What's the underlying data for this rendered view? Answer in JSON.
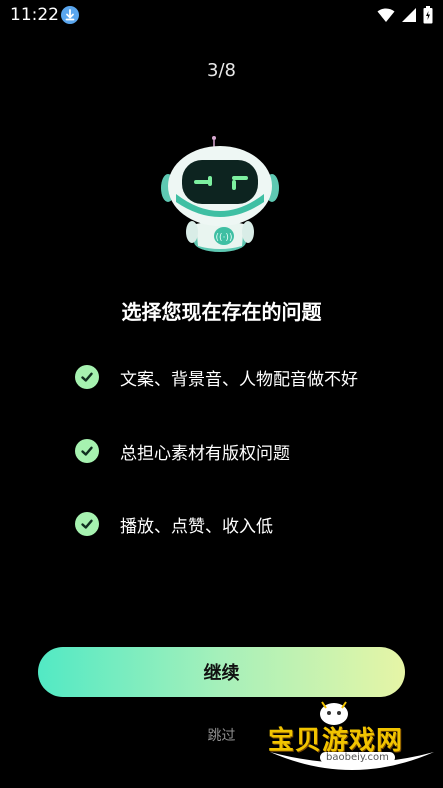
{
  "status_bar": {
    "time": "11:22"
  },
  "progress": "3/8",
  "question_title": "选择您现在存在的问题",
  "options": [
    {
      "label": "文案、背景音、人物配音做不好"
    },
    {
      "label": "总担心素材有版权问题"
    },
    {
      "label": "播放、点赞、收入低"
    }
  ],
  "continue_label": "继续",
  "skip_label": "跳过",
  "watermark": {
    "text": "宝贝游戏网",
    "url": "baobeiy.com"
  },
  "colors": {
    "accent_start": "#52e9c4",
    "accent_end": "#e6f5a6",
    "check": "#a6f2b0"
  },
  "icons": [
    "download-icon",
    "wifi-icon",
    "signal-icon",
    "battery-icon",
    "check-icon",
    "robot-mascot"
  ]
}
